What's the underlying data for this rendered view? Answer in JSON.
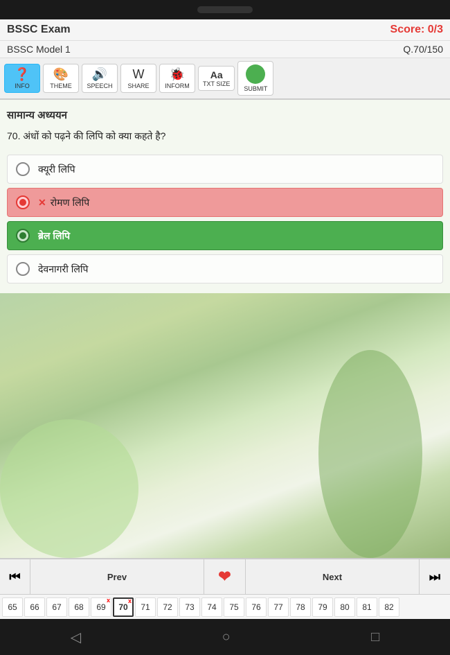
{
  "header": {
    "app_title": "BSSC Exam",
    "score_label": "Score: 0/3",
    "model_label": "BSSC Model 1",
    "question_counter": "Q.70/150"
  },
  "toolbar": {
    "help_label": "INFO",
    "theme_label": "THEME",
    "speech_label": "SPEECH",
    "share_label": "SHARE",
    "inform_label": "INFORM",
    "txt_size_label": "TXT SIZE",
    "submit_label": "SUBMIT"
  },
  "question": {
    "category": "सामान्य अध्ययन",
    "number": "70.",
    "text": "अंधों को पढ़ने की लिपि को क्या कहते है?",
    "options": [
      {
        "id": "A",
        "text": "क्यूरी लिपि",
        "state": "normal"
      },
      {
        "id": "B",
        "text": "रोमण लिपि",
        "state": "wrong"
      },
      {
        "id": "C",
        "text": "ब्रेल लिपि",
        "state": "correct"
      },
      {
        "id": "D",
        "text": "देवनागरी लिपि",
        "state": "normal"
      }
    ]
  },
  "navigation": {
    "prev_label": "Prev",
    "next_label": "Next",
    "skip_left_icon": "⏮",
    "skip_right_icon": "⏭",
    "heart_icon": "❤"
  },
  "q_strip": {
    "numbers": [
      65,
      66,
      67,
      68,
      69,
      70,
      71,
      72,
      73,
      74,
      75,
      76,
      77,
      78,
      79,
      80,
      81,
      82
    ],
    "active": 70,
    "wrong_marks": [
      69,
      70
    ]
  },
  "android_nav": {
    "back_icon": "◁",
    "home_icon": "○",
    "recent_icon": "□"
  }
}
